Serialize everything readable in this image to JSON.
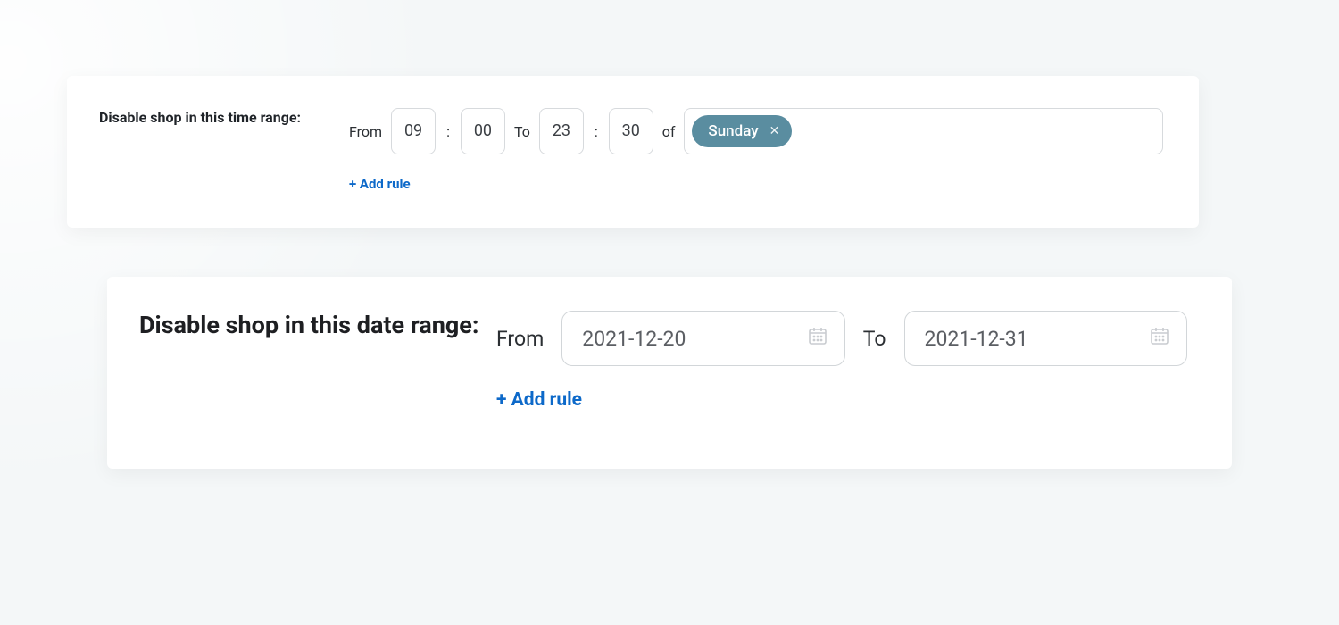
{
  "timeRange": {
    "label": "Disable shop in this time range:",
    "fromWord": "From",
    "toWord": "To",
    "ofWord": "of",
    "fromHour": "09",
    "fromMinute": "00",
    "toHour": "23",
    "toMinute": "30",
    "days": [
      "Sunday"
    ],
    "addRule": "+ Add rule"
  },
  "dateRange": {
    "label": "Disable shop in this date range:",
    "fromWord": "From",
    "toWord": "To",
    "fromDate": "2021-12-20",
    "toDate": "2021-12-31",
    "addRule": "+ Add rule"
  }
}
